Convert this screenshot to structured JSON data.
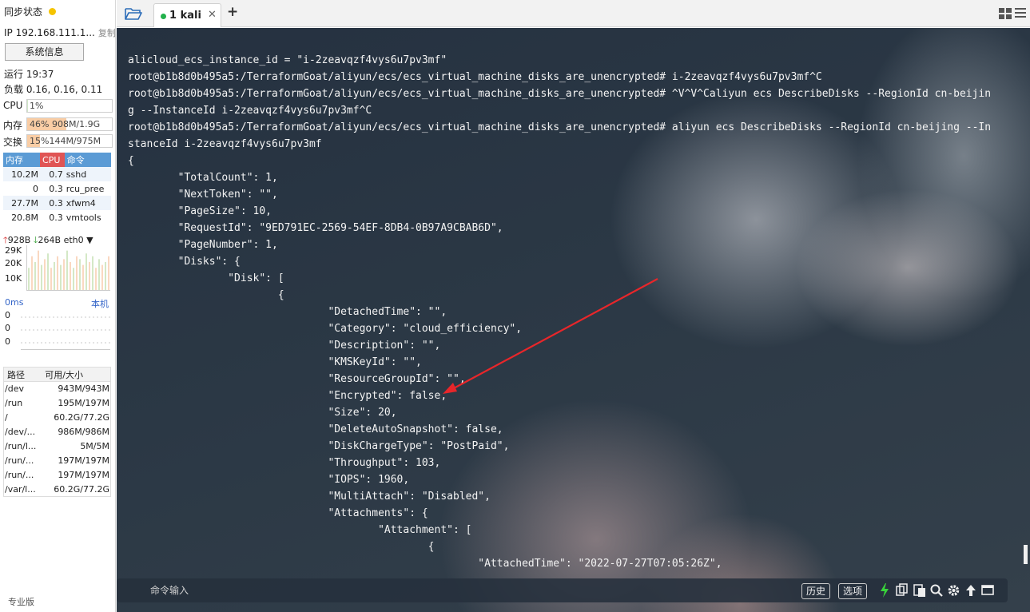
{
  "sidebar": {
    "sync_status": "同步状态",
    "ip": "IP 192.168.111.1...",
    "copy": "复制",
    "sysinfo_button": "系统信息",
    "uptime": "运行 19:37",
    "load": "负载 0.16, 0.16, 0.11",
    "cpu": {
      "label": "CPU",
      "text": "1%",
      "percent": 1
    },
    "mem": {
      "label": "内存",
      "text": "46%  908M/1.9G",
      "percent": 46
    },
    "swap": {
      "label": "交换",
      "text": "15%144M/975M",
      "percent": 15
    },
    "proc_headers": [
      "内存",
      "CPU",
      "命令"
    ],
    "processes": [
      {
        "mem": "10.2M",
        "cpu": "0.7",
        "cmd": "sshd"
      },
      {
        "mem": "0",
        "cpu": "0.3",
        "cmd": "rcu_pree"
      },
      {
        "mem": "27.7M",
        "cpu": "0.3",
        "cmd": "xfwm4"
      },
      {
        "mem": "20.8M",
        "cpu": "0.3",
        "cmd": "vmtools"
      }
    ],
    "net": {
      "up": "928B",
      "down": "264B",
      "iface": "eth0",
      "y_ticks": [
        "29K",
        "20K",
        "10K"
      ]
    },
    "latency": {
      "label": "0ms",
      "host": "本机",
      "values": [
        "0",
        "0",
        "0"
      ]
    },
    "disk_headers": [
      "路径",
      "可用/大小"
    ],
    "disks": [
      {
        "path": "/dev",
        "size": "943M/943M"
      },
      {
        "path": "/run",
        "size": "195M/197M"
      },
      {
        "path": "/",
        "size": "60.2G/77.2G"
      },
      {
        "path": "/dev/...",
        "size": "986M/986M"
      },
      {
        "path": "/run/l...",
        "size": "5M/5M"
      },
      {
        "path": "/run/...",
        "size": "197M/197M"
      },
      {
        "path": "/run/...",
        "size": "197M/197M"
      },
      {
        "path": "/var/l...",
        "size": "60.2G/77.2G"
      }
    ],
    "edition": "专业版"
  },
  "tabs": [
    {
      "label": "1 kali",
      "active": true
    }
  ],
  "icons": {
    "folder": "folder-open-icon",
    "add": "plus-icon",
    "layout": "grid-layout-icon",
    "menu": "hamburger-menu-icon"
  },
  "terminal": {
    "lines": [
      "alicloud_ecs_instance_id = \"i-2zeavqzf4vys6u7pv3mf\"",
      "root@b1b8d0b495a5:/TerraformGoat/aliyun/ecs/ecs_virtual_machine_disks_are_unencrypted# i-2zeavqzf4vys6u7pv3mf^C",
      "root@b1b8d0b495a5:/TerraformGoat/aliyun/ecs/ecs_virtual_machine_disks_are_unencrypted# ^V^V^Caliyun ecs DescribeDisks --RegionId cn-beijin",
      "g --InstanceId i-2zeavqzf4vys6u7pv3mf^C",
      "root@b1b8d0b495a5:/TerraformGoat/aliyun/ecs/ecs_virtual_machine_disks_are_unencrypted# aliyun ecs DescribeDisks --RegionId cn-beijing --In",
      "stanceId i-2zeavqzf4vys6u7pv3mf",
      "{",
      "        \"TotalCount\": 1,",
      "        \"NextToken\": \"\",",
      "        \"PageSize\": 10,",
      "        \"RequestId\": \"9ED791EC-2569-54EF-8DB4-0B97A9CBAB6D\",",
      "        \"PageNumber\": 1,",
      "        \"Disks\": {",
      "                \"Disk\": [",
      "                        {",
      "                                \"DetachedTime\": \"\",",
      "                                \"Category\": \"cloud_efficiency\",",
      "                                \"Description\": \"\",",
      "                                \"KMSKeyId\": \"\",",
      "                                \"ResourceGroupId\": \"\",",
      "                                \"Encrypted\": false,",
      "                                \"Size\": 20,",
      "                                \"DeleteAutoSnapshot\": false,",
      "                                \"DiskChargeType\": \"PostPaid\",",
      "                                \"Throughput\": 103,",
      "                                \"IOPS\": 1960,",
      "                                \"MultiAttach\": \"Disabled\",",
      "                                \"Attachments\": {",
      "                                        \"Attachment\": [",
      "                                                {",
      "                                                        \"AttachedTime\": \"2022-07-27T07:05:26Z\","
    ]
  },
  "cmdbar": {
    "placeholder": "命令输入",
    "history": "历史",
    "options": "选项"
  },
  "colors": {
    "arrow": "#e8262a",
    "tab_dot": "#22b14c",
    "status_dot": "#f5c400"
  }
}
